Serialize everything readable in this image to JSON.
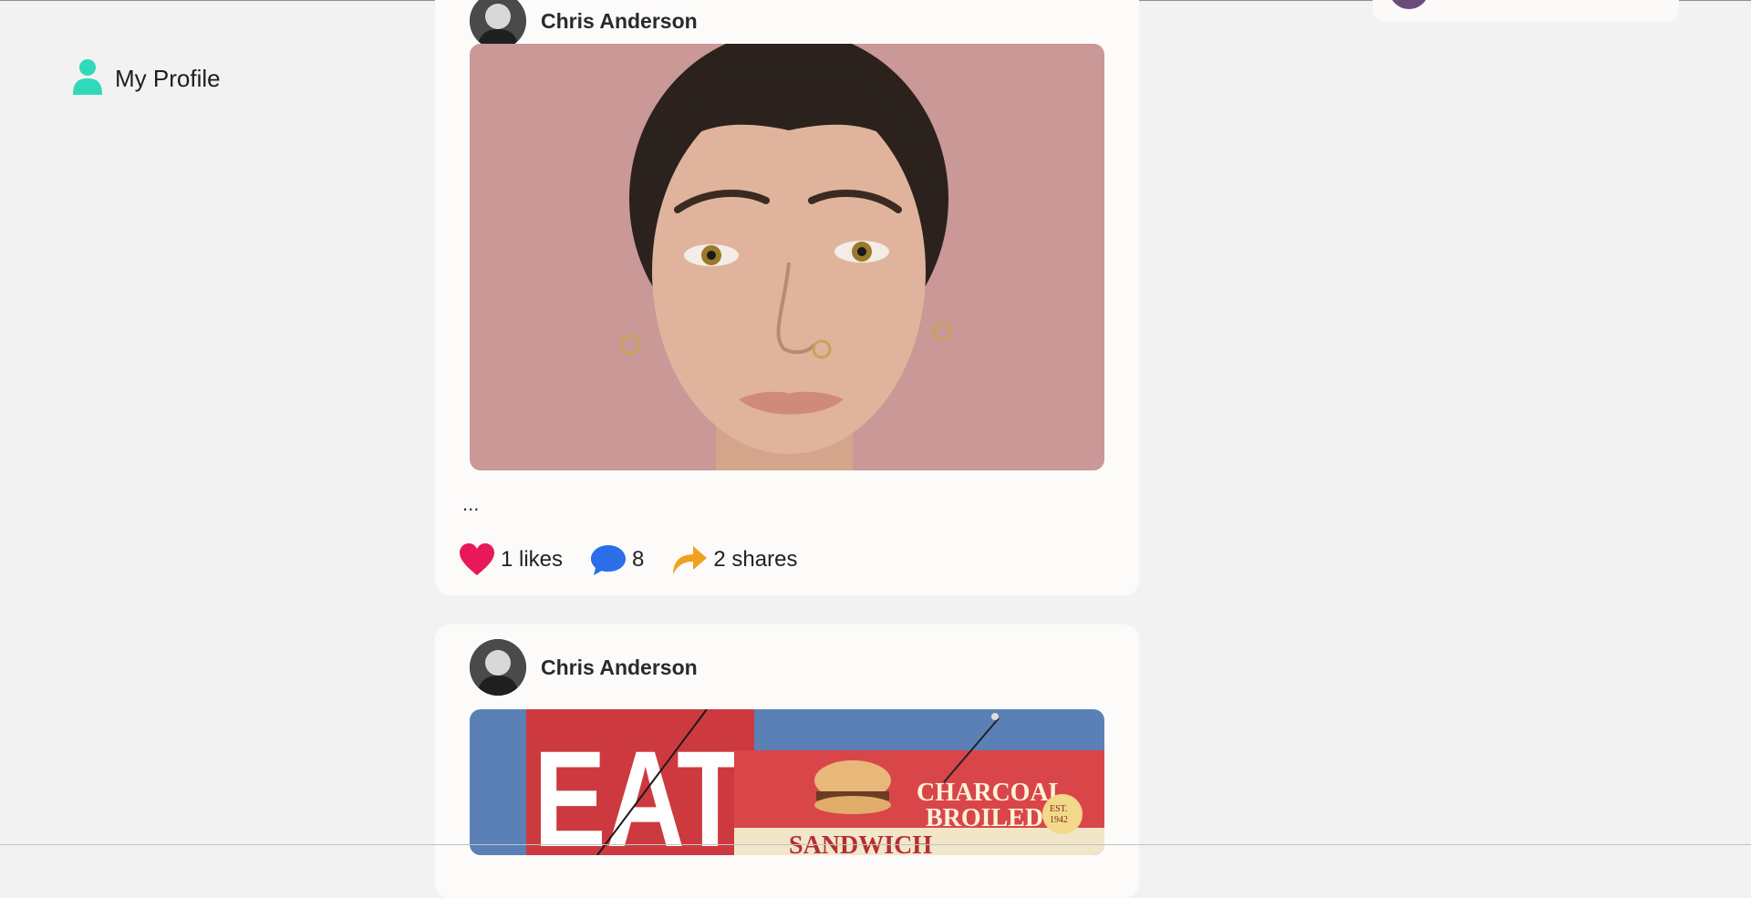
{
  "sidebar": {
    "items": [
      {
        "label": "My Profile",
        "icon": "user-icon",
        "color": "#2fd9b9"
      }
    ]
  },
  "posts": [
    {
      "author": "Chris Anderson",
      "text": "...",
      "image": "portrait-photo",
      "likes_label": "1 likes",
      "comments_label": "8",
      "shares_label": "2 shares"
    },
    {
      "author": "Chris Anderson",
      "image": "eat-sign-photo",
      "sign": {
        "word": "EAT",
        "line1": "CHARCOAL",
        "line2": "BROILED",
        "badge_top": "EST.",
        "badge_year": "1942",
        "partial": "SANDWICH"
      }
    }
  ],
  "colors": {
    "accent": "#2fd9b9",
    "like": "#e8185a",
    "comment": "#2a6fe8",
    "share": "#f0a21e",
    "background": "#f2f2f2",
    "card": "#fcfbfa"
  }
}
